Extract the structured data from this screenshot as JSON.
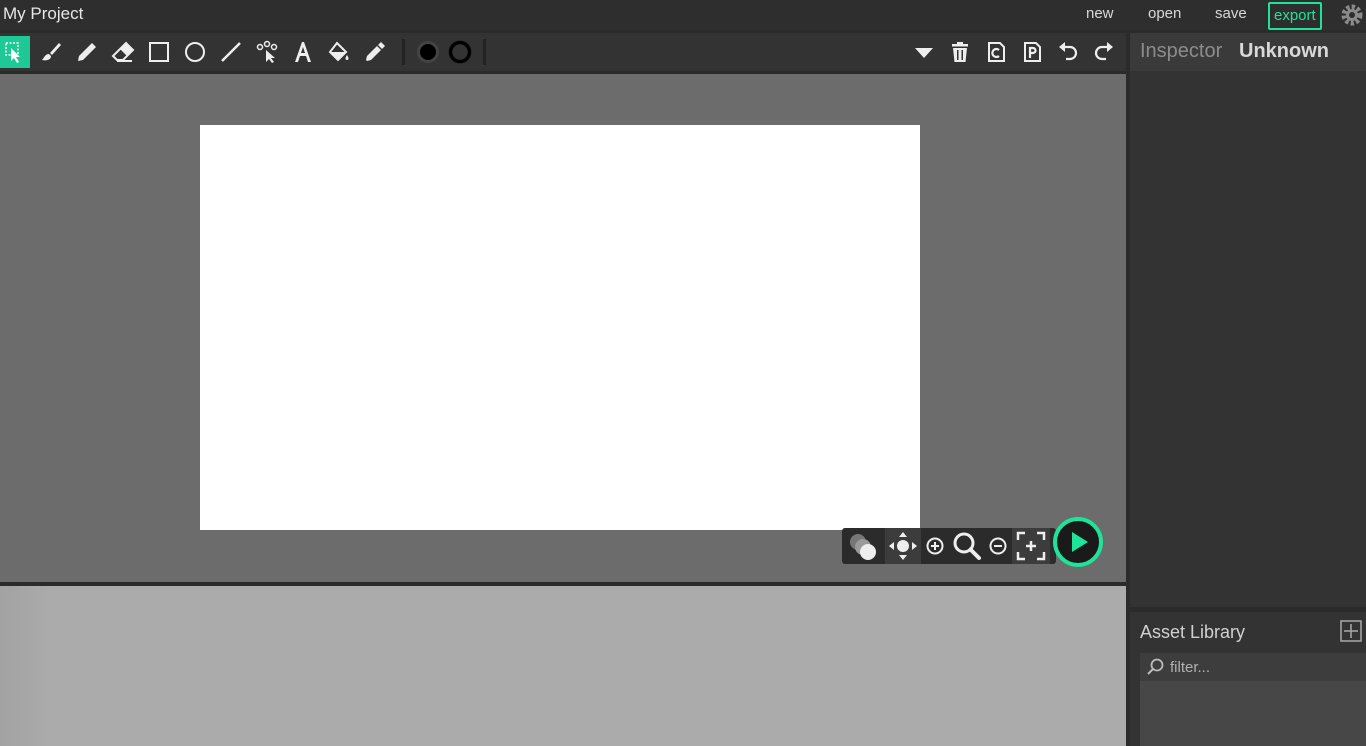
{
  "app": {
    "project_title": "My Project"
  },
  "menu": {
    "new": "new",
    "open": "open",
    "save": "save",
    "export": "export"
  },
  "inspector": {
    "label": "Inspector",
    "selection_type": "Unknown"
  },
  "assets": {
    "title": "Asset Library",
    "filter_placeholder": "filter..."
  },
  "colors": {
    "accent": "#1ee39b",
    "fill_color": "#000000",
    "stroke_color": "#000000",
    "stage_background": "#ffffff"
  },
  "tools": [
    "cursor-icon",
    "brush-icon",
    "pencil-icon",
    "eraser-icon",
    "rectangle-icon",
    "ellipse-icon",
    "line-icon",
    "path-edit-icon",
    "text-icon",
    "fill-bucket-icon",
    "eyedropper-icon"
  ],
  "actions": [
    "dropdown-icon",
    "delete-icon",
    "copy-icon",
    "paste-icon",
    "undo-icon",
    "redo-icon"
  ],
  "canvas_controls": [
    "onion-skin-icon",
    "pan-icon",
    "zoom-in-icon",
    "zoom-icon",
    "zoom-out-icon",
    "fit-screen-icon",
    "play-icon"
  ]
}
